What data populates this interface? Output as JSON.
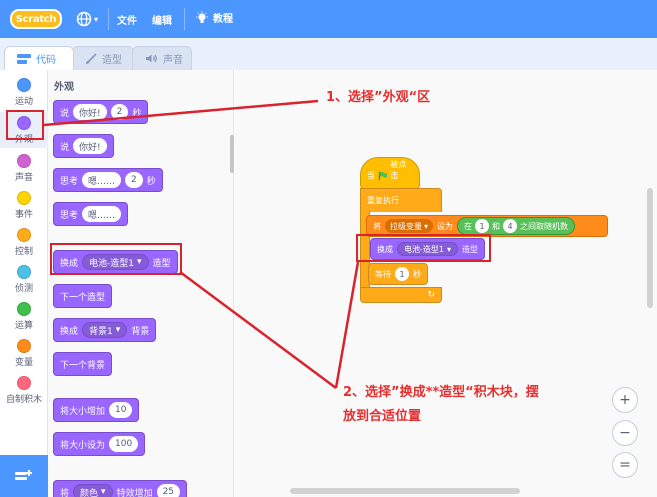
{
  "app": {
    "logo_text": "Scratch",
    "menu": {
      "file": "文件",
      "edit": "编辑",
      "tutorials": "教程"
    }
  },
  "tabs": [
    {
      "label": "代码",
      "icon": "code-icon",
      "active": true
    },
    {
      "label": "造型",
      "icon": "brush-icon",
      "active": false
    },
    {
      "label": "声音",
      "icon": "speaker-icon",
      "active": false
    }
  ],
  "categories": [
    {
      "label": "运动",
      "color": "#4c97ff"
    },
    {
      "label": "外观",
      "color": "#9966ff"
    },
    {
      "label": "声音",
      "color": "#cf63cf"
    },
    {
      "label": "事件",
      "color": "#ffd500"
    },
    {
      "label": "控制",
      "color": "#ffab19"
    },
    {
      "label": "侦测",
      "color": "#4cbfe6"
    },
    {
      "label": "运算",
      "color": "#40bf4a"
    },
    {
      "label": "变量",
      "color": "#ff8c1a"
    },
    {
      "label": "自制积木",
      "color": "#ff6680"
    }
  ],
  "palette": {
    "title": "外观",
    "say_timed": {
      "op": "说",
      "text": "你好!",
      "secs": "2",
      "unit": "秒"
    },
    "say": {
      "op": "说",
      "text": "你好!"
    },
    "think_timed": {
      "op": "思考",
      "text": "嗯……",
      "secs": "2",
      "unit": "秒"
    },
    "think": {
      "op": "思考",
      "text": "嗯……"
    },
    "switch_costume": {
      "op": "换成",
      "value": "电池-造型1",
      "suffix": "造型"
    },
    "next_costume": "下一个造型",
    "switch_backdrop": {
      "op": "换成",
      "value": "背景1",
      "suffix": "背景"
    },
    "next_backdrop": "下一个背景",
    "change_size": {
      "op": "将大小增加",
      "value": "10"
    },
    "set_size": {
      "op": "将大小设为",
      "value": "100"
    },
    "change_effect": {
      "op": "将",
      "value": "颜色",
      "mid": "特效增加",
      "num": "25"
    }
  },
  "script": {
    "hat": {
      "text": "当",
      "suffix": "被点击"
    },
    "forever": "重复执行",
    "set_var": {
      "op": "将",
      "var": "拉级变量",
      "mid": "设为",
      "rand_prefix": "在",
      "from": "1",
      "and": "和",
      "to": "4",
      "rand_suffix": "之间取随机数"
    },
    "switch": {
      "op": "换成",
      "value": "电池-造型1",
      "suffix": "造型"
    },
    "wait": {
      "op": "等待",
      "value": "1",
      "unit": "秒"
    }
  },
  "annotations": {
    "step1": "1、选择”外观“区",
    "step2_line1": "2、选择”换成**造型“积木块，摆",
    "step2_line2": "放到合适位置"
  },
  "zoom": {
    "in": "+",
    "out": "−",
    "reset": "="
  }
}
